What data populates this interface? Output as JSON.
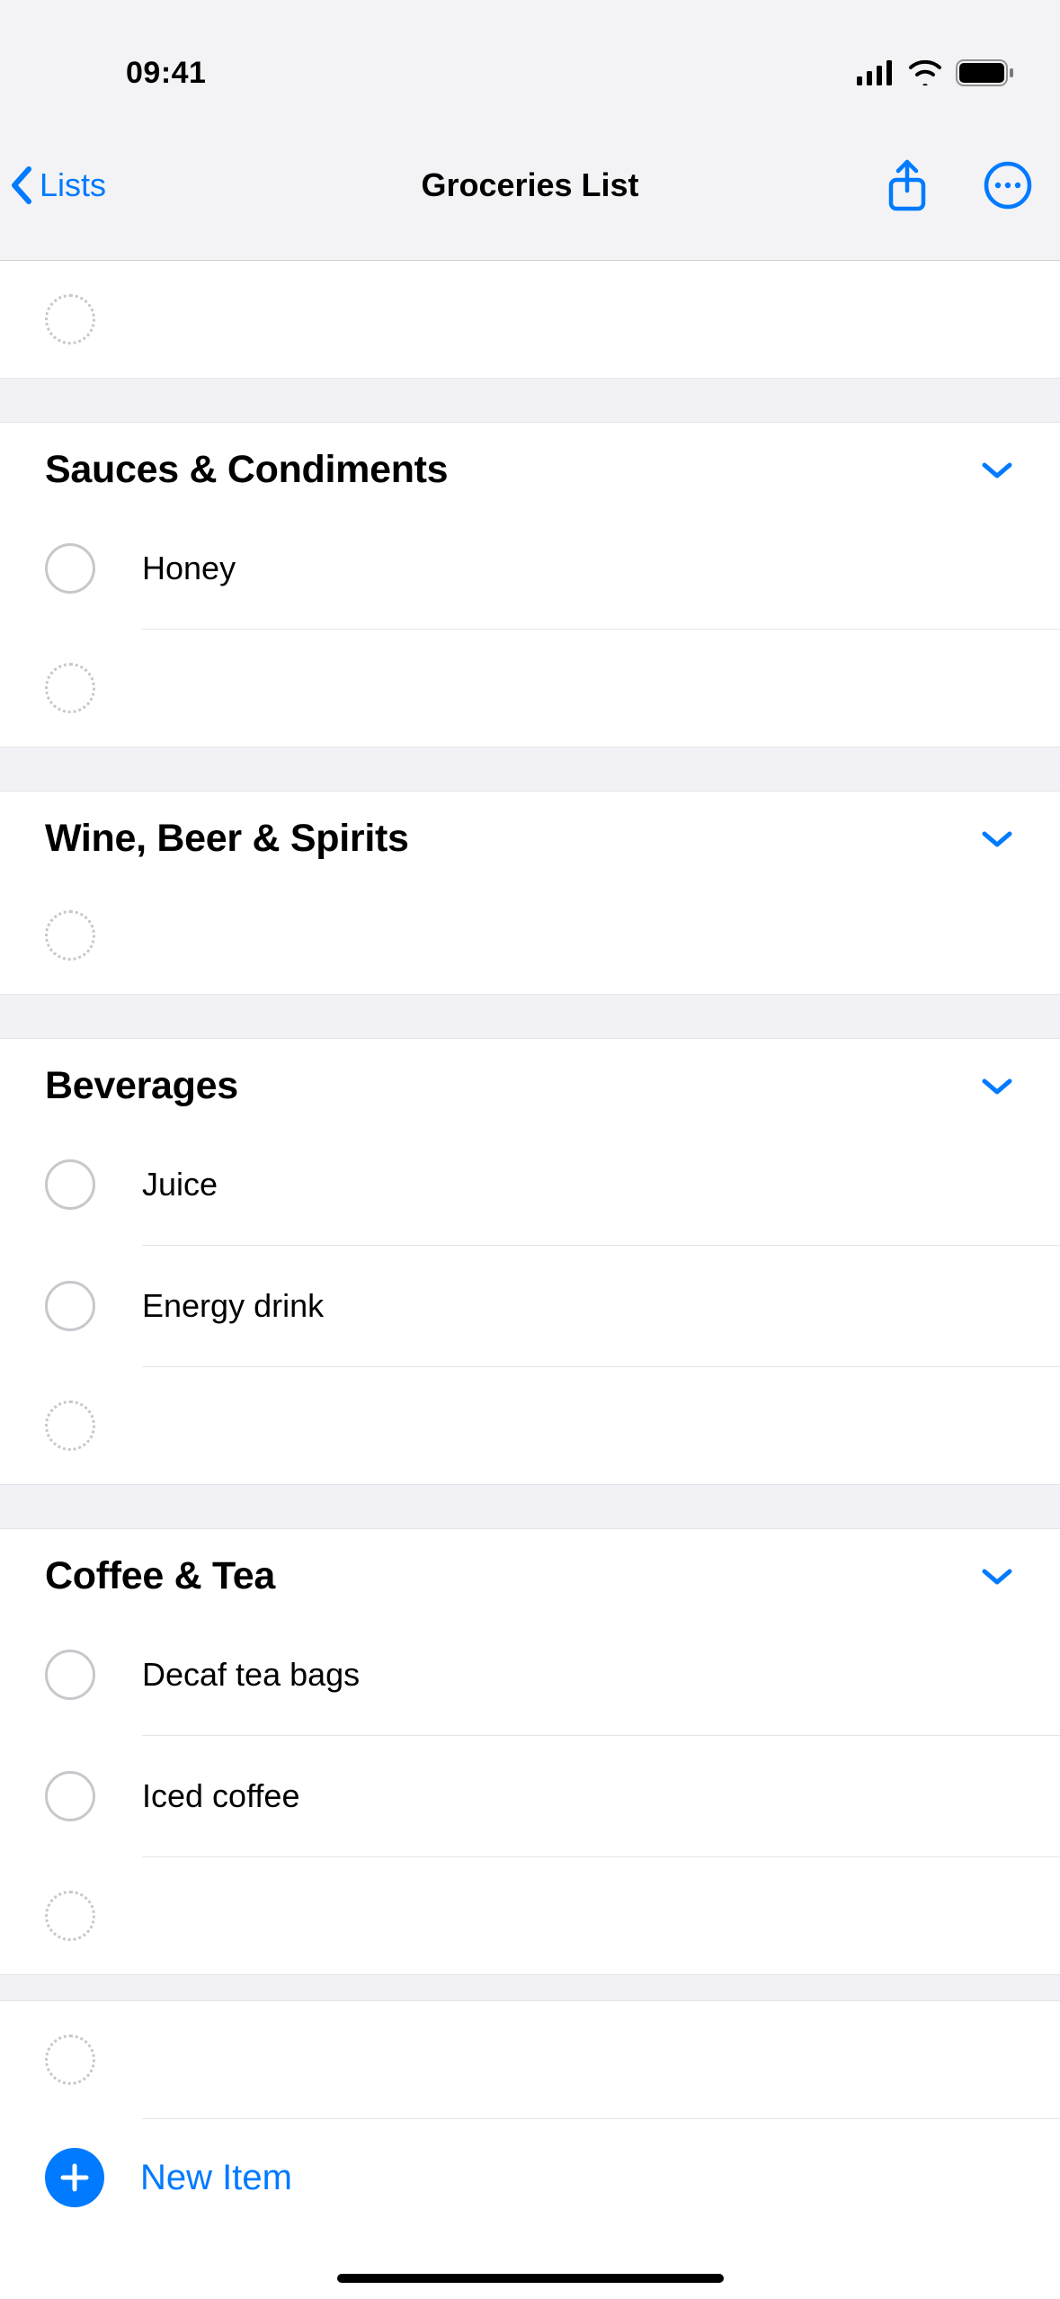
{
  "statusBar": {
    "time": "09:41"
  },
  "nav": {
    "back_label": "Lists",
    "title": "Groceries List"
  },
  "sections": [
    {
      "title": "Sauces & Condiments",
      "items": [
        "Honey"
      ]
    },
    {
      "title": "Wine, Beer & Spirits",
      "items": []
    },
    {
      "title": "Beverages",
      "items": [
        "Juice",
        "Energy drink"
      ]
    },
    {
      "title": "Coffee & Tea",
      "items": [
        "Decaf tea bags",
        "Iced coffee"
      ]
    }
  ],
  "newItem": {
    "label": "New Item"
  },
  "colors": {
    "accent": "#007aff"
  }
}
